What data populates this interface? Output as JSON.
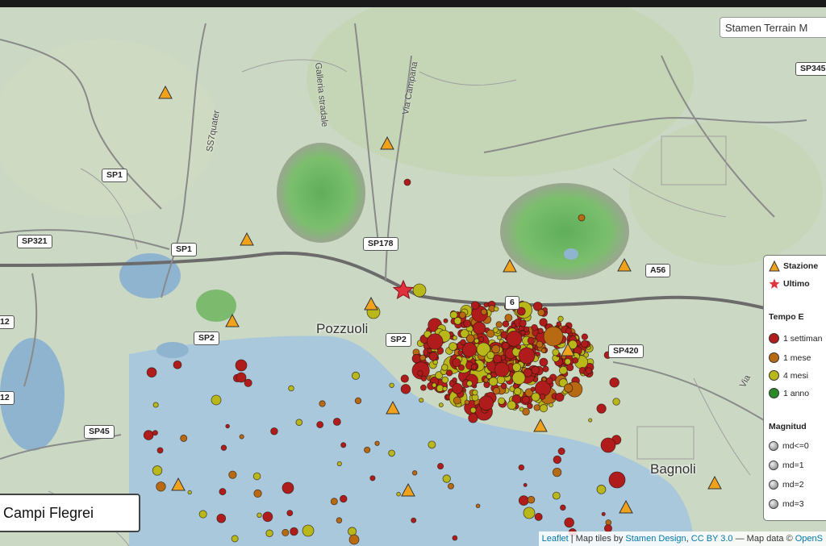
{
  "map": {
    "tile_layer_label": "Stamen Terrain M",
    "title": "Campi Flegrei",
    "places": [
      {
        "id": "pozzuoli",
        "label": "Pozzuoli"
      },
      {
        "id": "bagnoli",
        "label": "Bagnoli"
      }
    ],
    "road_shields": [
      "SP1",
      "SP1",
      "SP321",
      "SP2",
      "SP45",
      "SP178",
      "SP420",
      "A56",
      "SP345",
      "12",
      "12",
      "SP2",
      "6"
    ],
    "street_labels": [
      "Galleria stradale",
      "Via Campana",
      "SS7quater",
      "Via"
    ],
    "attribution": {
      "leaflet": "Leaflet",
      "sep1": " | Map tiles by ",
      "stamen": "Stamen Design",
      "comma": ", ",
      "license": "CC BY 3.0",
      "sep2": " — Map data © ",
      "osm": "OpenS"
    }
  },
  "legend": {
    "station_label": "Stazione",
    "last_label": "Ultimo",
    "time_header": "Tempo E",
    "time_items": [
      {
        "label": "1 settiman",
        "color": "#b01c1c"
      },
      {
        "label": "1 mese",
        "color": "#b86a12"
      },
      {
        "label": "4 mesi",
        "color": "#b8b81a"
      },
      {
        "label": "1 anno",
        "color": "#2a8a2a"
      }
    ],
    "mag_header": "Magnitud",
    "mag_items": [
      "md<=0",
      "md=1",
      "md=2",
      "md=3"
    ]
  },
  "colors": {
    "sea": "#a9c8dc",
    "land": "#cdd9c6",
    "crater": "#6fb56a",
    "station": "#f0a21c",
    "star": "#e0323c"
  }
}
